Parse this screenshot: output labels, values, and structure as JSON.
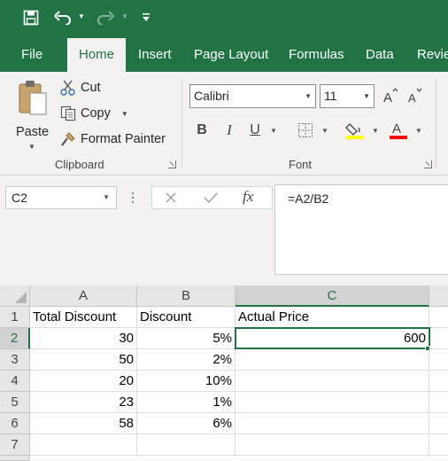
{
  "qat": {
    "icons": [
      "save-icon",
      "undo-icon",
      "redo-icon",
      "customize-qat-icon"
    ]
  },
  "tabs": [
    {
      "label": "File"
    },
    {
      "label": "Home"
    },
    {
      "label": "Insert"
    },
    {
      "label": "Page Layout"
    },
    {
      "label": "Formulas"
    },
    {
      "label": "Data"
    },
    {
      "label": "Revie"
    }
  ],
  "active_tab": "Home",
  "ribbon": {
    "clipboard": {
      "paste_label": "Paste",
      "cut_label": "Cut",
      "copy_label": "Copy",
      "format_painter_label": "Format Painter",
      "group_label": "Clipboard"
    },
    "font": {
      "font_name": "Calibri",
      "font_size": "11",
      "bold": "B",
      "italic": "I",
      "underline": "U",
      "group_label": "Font",
      "highlight_color": "#ffff00",
      "font_color": "#ff0000"
    }
  },
  "formula_bar": {
    "name_box": "C2",
    "formula": "=A2/B2"
  },
  "sheet": {
    "columns": [
      "A",
      "B",
      "C"
    ],
    "selected_column": "C",
    "rows": [
      {
        "num": "1",
        "a": "Total Discount",
        "b": "Discount",
        "c": "Actual Price"
      },
      {
        "num": "2",
        "a": "30",
        "b": "5%",
        "c": "600"
      },
      {
        "num": "3",
        "a": "50",
        "b": "2%",
        "c": ""
      },
      {
        "num": "4",
        "a": "20",
        "b": "10%",
        "c": ""
      },
      {
        "num": "5",
        "a": "23",
        "b": "1%",
        "c": ""
      },
      {
        "num": "6",
        "a": "58",
        "b": "6%",
        "c": ""
      },
      {
        "num": "7",
        "a": "",
        "b": "",
        "c": ""
      }
    ],
    "selected_row": "2",
    "accent_color": "#217346"
  }
}
